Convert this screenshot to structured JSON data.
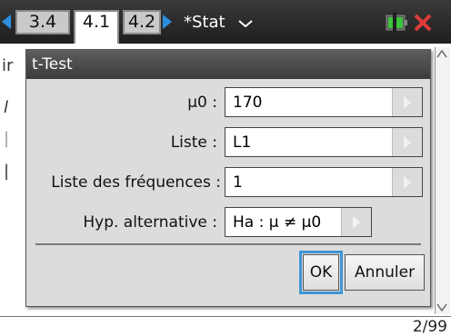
{
  "topbar": {
    "tabs": [
      {
        "label": "3.4",
        "active": false
      },
      {
        "label": "4.1",
        "active": true
      },
      {
        "label": "4.2",
        "active": false
      }
    ],
    "document_title": "*Stat"
  },
  "background": {
    "partial_texts": [
      "ir",
      "l",
      "|",
      "|"
    ]
  },
  "dialog": {
    "title": "t-Test",
    "fields": [
      {
        "label": "μ0 :",
        "value": "170",
        "type": "input"
      },
      {
        "label": "Liste :",
        "value": "L1",
        "type": "input"
      },
      {
        "label": "Liste des fréquences :",
        "value": "1",
        "type": "input"
      },
      {
        "label": "Hyp. alternative :",
        "value": "Ha : μ ≠ μ0",
        "type": "select"
      }
    ],
    "ok_label": "OK",
    "cancel_label": "Annuler"
  },
  "status": {
    "page_indicator": "2/99"
  },
  "colors": {
    "accent": "#2b8fe0",
    "focus": "#3f96d6",
    "titlebar": "#4a4a4a",
    "dialog_bg": "#dcdcdc"
  }
}
